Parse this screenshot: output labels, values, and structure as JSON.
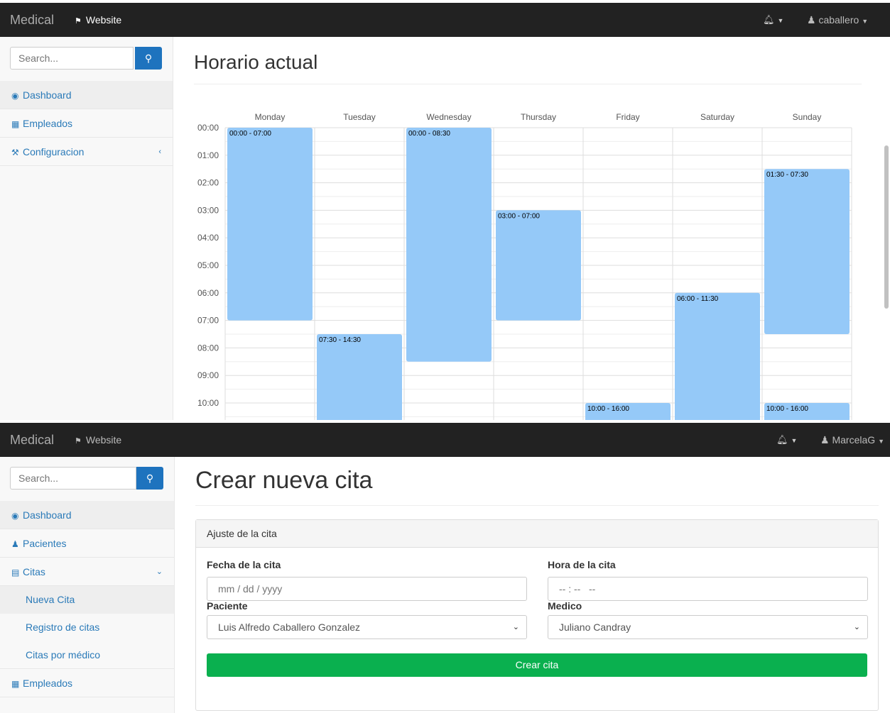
{
  "screen1": {
    "navbar": {
      "brand": "Medical",
      "website_label": "Website",
      "user": "caballero"
    },
    "search": {
      "placeholder": "Search..."
    },
    "sidebar": {
      "items": [
        {
          "label": "Dashboard",
          "icon": "dashboard-icon"
        },
        {
          "label": "Empleados",
          "icon": "table-icon"
        },
        {
          "label": "Configuracion",
          "icon": "wrench-icon"
        }
      ]
    },
    "title": "Horario actual",
    "schedule": {
      "days": [
        "Monday",
        "Tuesday",
        "Wednesday",
        "Thursday",
        "Friday",
        "Saturday",
        "Sunday"
      ],
      "hours": [
        "00:00",
        "01:00",
        "02:00",
        "03:00",
        "04:00",
        "05:00",
        "06:00",
        "07:00",
        "08:00",
        "09:00",
        "10:00"
      ],
      "events": [
        {
          "day": 0,
          "start": 0,
          "end": 7,
          "label": "00:00 - 07:00"
        },
        {
          "day": 1,
          "start": 7.5,
          "end": 14.5,
          "label": "07:30 - 14:30"
        },
        {
          "day": 2,
          "start": 0,
          "end": 8.5,
          "label": "00:00 - 08:30"
        },
        {
          "day": 3,
          "start": 3,
          "end": 7,
          "label": "03:00 - 07:00"
        },
        {
          "day": 4,
          "start": 10,
          "end": 16,
          "label": "10:00 - 16:00"
        },
        {
          "day": 5,
          "start": 6,
          "end": 11.5,
          "label": "06:00 - 11:30"
        },
        {
          "day": 6,
          "start": 1.5,
          "end": 7.5,
          "label": "01:30 - 07:30"
        },
        {
          "day": 6,
          "start": 10,
          "end": 16,
          "label": "10:00 - 16:00"
        }
      ],
      "event_color": "#95c9f8"
    }
  },
  "screen2": {
    "navbar": {
      "brand": "Medical",
      "website_label": "Website",
      "user": "MarcelaG"
    },
    "search": {
      "placeholder": "Search..."
    },
    "sidebar": {
      "items": [
        {
          "label": "Dashboard",
          "icon": "dashboard-icon"
        },
        {
          "label": "Pacientes",
          "icon": "users-icon"
        },
        {
          "label": "Citas",
          "icon": "calendar-icon"
        }
      ],
      "sub_items": [
        "Nueva Cita",
        "Registro de citas",
        "Citas por médico"
      ],
      "after": {
        "label": "Empleados",
        "icon": "table-icon"
      }
    },
    "title": "Crear nueva cita",
    "form": {
      "card_title": "Ajuste de la cita",
      "date_label": "Fecha de la cita",
      "date_placeholder": "mm / dd / yyyy",
      "time_label": "Hora de la cita",
      "time_placeholder": "-- : --   --",
      "patient_label": "Paciente",
      "patient_value": "Luis Alfredo Caballero Gonzalez",
      "doctor_label": "Medico",
      "doctor_value": "Juliano Candray",
      "submit_label": "Crear cita",
      "submit_color": "#0ab04f"
    }
  }
}
